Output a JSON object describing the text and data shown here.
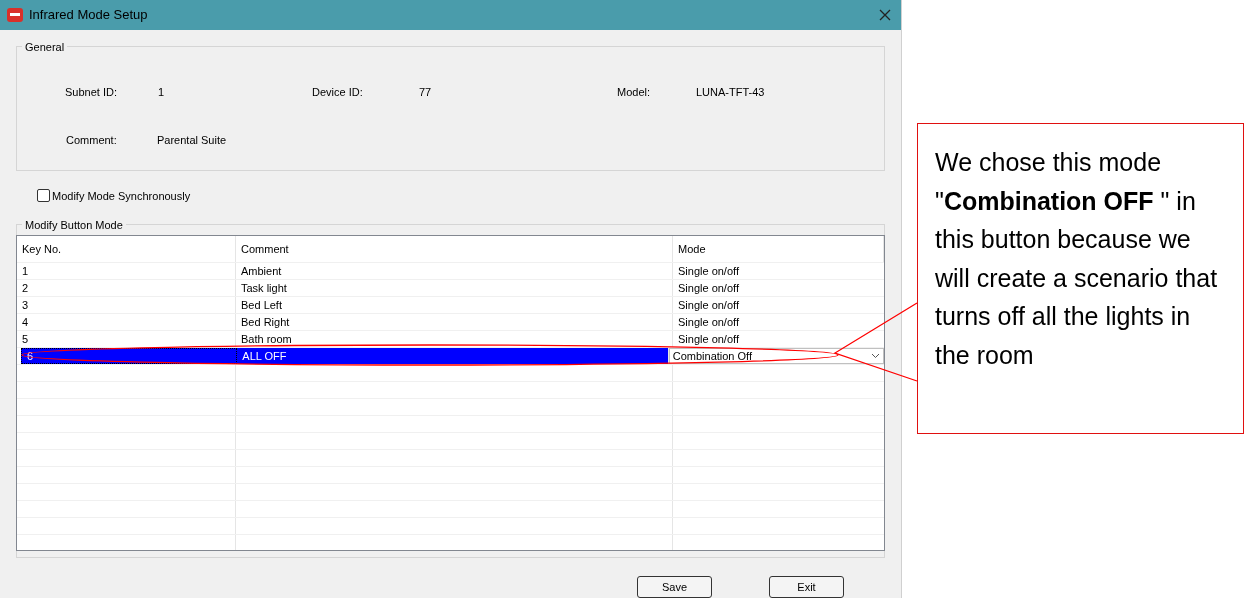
{
  "window": {
    "title": "Infrared Mode Setup"
  },
  "general": {
    "title": "General",
    "fields": [
      {
        "label": "Subnet ID:",
        "value": "1"
      },
      {
        "label": "Device ID:",
        "value": "77"
      },
      {
        "label": "Model:",
        "value": "LUNA-TFT-43"
      },
      {
        "label": "Comment:",
        "value": "Parental Suite"
      }
    ]
  },
  "sync_checkbox": {
    "label": "Modify Mode Synchronously",
    "checked": false
  },
  "modify": {
    "title": "Modify Button Mode",
    "columns": [
      "Key No.",
      "Comment",
      "Mode"
    ],
    "rows": [
      {
        "key": "1",
        "comment": "Ambient",
        "mode": "Single on/off",
        "selected": false
      },
      {
        "key": "2",
        "comment": "Task light",
        "mode": "Single on/off",
        "selected": false
      },
      {
        "key": "3",
        "comment": "Bed Left",
        "mode": "Single on/off",
        "selected": false
      },
      {
        "key": "4",
        "comment": "Bed Right",
        "mode": "Single on/off",
        "selected": false
      },
      {
        "key": "5",
        "comment": "Bath room",
        "mode": "Single on/off",
        "selected": false
      },
      {
        "key": "6",
        "comment": "ALL OFF",
        "mode": "Combination Off",
        "selected": true
      }
    ]
  },
  "buttons": [
    "Save",
    "Exit"
  ],
  "callout": {
    "text": "We chose this mode \"**Combination OFF** \" in this button because we will create a scenario that turns off all the lights in the room"
  }
}
